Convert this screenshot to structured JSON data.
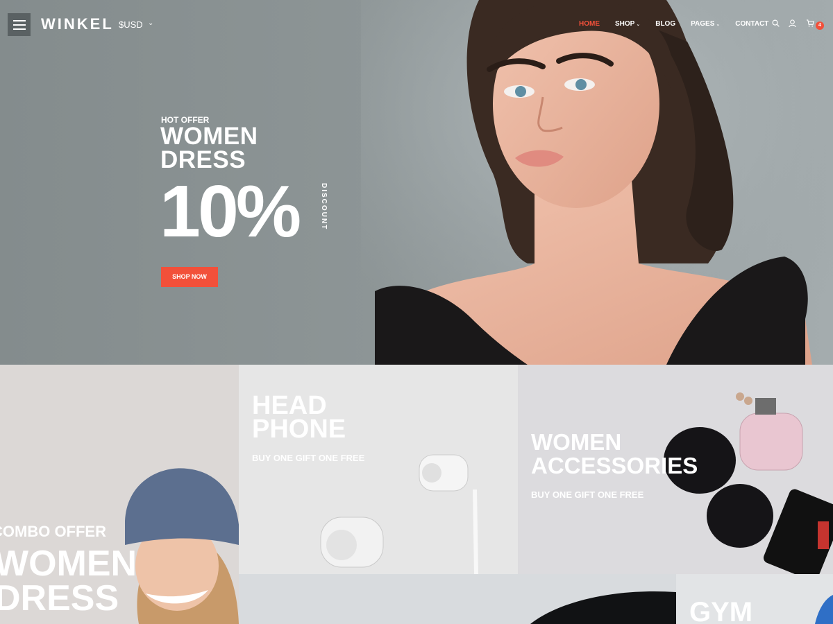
{
  "header": {
    "logo": "WINKEL",
    "currency": "$USD",
    "nav": [
      {
        "label": "HOME",
        "active": true,
        "dropdown": false
      },
      {
        "label": "SHOP",
        "active": false,
        "dropdown": true
      },
      {
        "label": "BLOG",
        "active": false,
        "dropdown": false
      },
      {
        "label": "PAGES",
        "active": false,
        "dropdown": true
      },
      {
        "label": "CONTACT",
        "active": false,
        "dropdown": false
      }
    ],
    "icons": [
      "search-icon",
      "user-icon",
      "cart-icon"
    ],
    "cart_count": "4"
  },
  "hero": {
    "kicker": "HOT OFFER",
    "title_line1": "WOMEN",
    "title_line2": "DRESS",
    "percent": "10%",
    "discount": "DISCOUNT",
    "button": "SHOP NOW"
  },
  "banners": {
    "combo": {
      "kicker": "COMBO OFFER",
      "title_line1": "WOMEN",
      "title_line2": "DRESS"
    },
    "headphone": {
      "title_line1": "HEAD",
      "title_line2": "PHONE",
      "subtitle": "BUY ONE GIFT ONE FREE"
    },
    "accessories": {
      "title_line1": "WOMEN",
      "title_line2": "ACCESSORIES",
      "subtitle": "BUY ONE GIFT ONE FREE"
    },
    "gym": {
      "title": "GYM"
    }
  },
  "colors": {
    "accent": "#f2503a",
    "hero_bg": "#8d9596",
    "dark_button": "#5a6163"
  }
}
